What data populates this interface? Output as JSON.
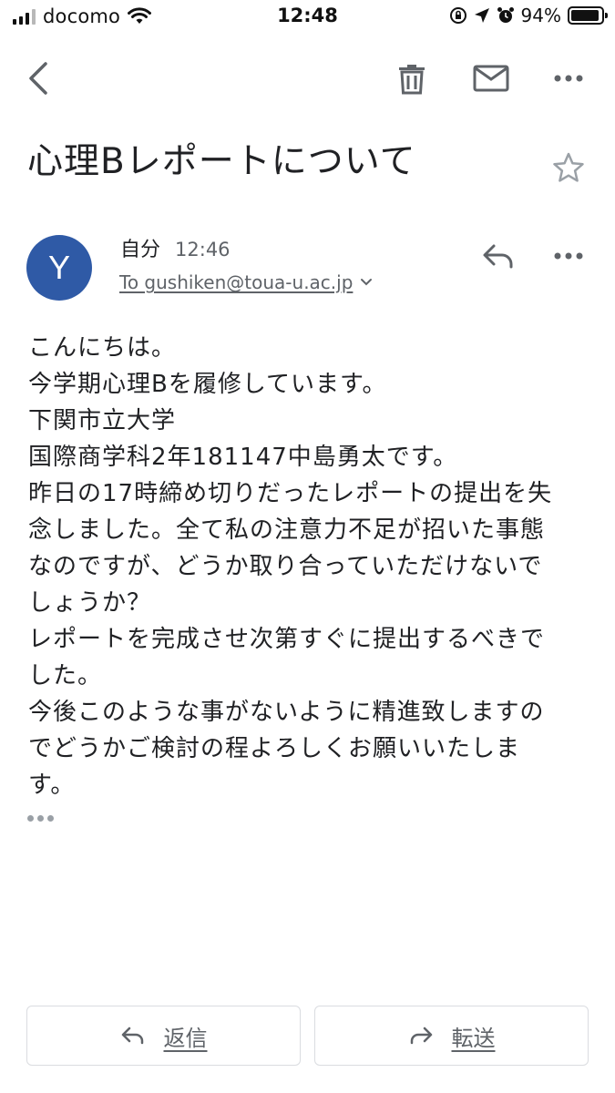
{
  "status_bar": {
    "carrier": "docomo",
    "time": "12:48",
    "battery_percent": "94%",
    "battery_level": 0.94
  },
  "toolbar": {
    "icons": [
      "back-icon",
      "trash-icon",
      "mail-icon",
      "more-icon"
    ]
  },
  "email": {
    "subject": "心理Bレポートについて",
    "sender": {
      "avatar_letter": "Y",
      "avatar_color": "#2f5aa6",
      "name": "自分",
      "time": "12:46",
      "recipient": "To gushiken@toua-u.ac.jp"
    },
    "body_lines": [
      "こんにちは。",
      "今学期心理Bを履修しています。",
      "下関市立大学",
      "国際商学科2年181147中島勇太です。",
      "昨日の17時締め切りだったレポートの提出を失",
      "念しました。全て私の注意力不足が招いた事態",
      "なのですが、どうか取り合っていただけないで",
      "しょうか？",
      "レポートを完成させ次第すぐに提出するべきで",
      "した。",
      "今後このような事がないように精進致しますの",
      "でどうかご検討の程よろしくお願いいたしま",
      "す。"
    ]
  },
  "actions": {
    "reply_label": "返信",
    "forward_label": "転送"
  },
  "colors": {
    "text": "#202124",
    "secondary": "#5f6368",
    "border": "#dadce0"
  }
}
